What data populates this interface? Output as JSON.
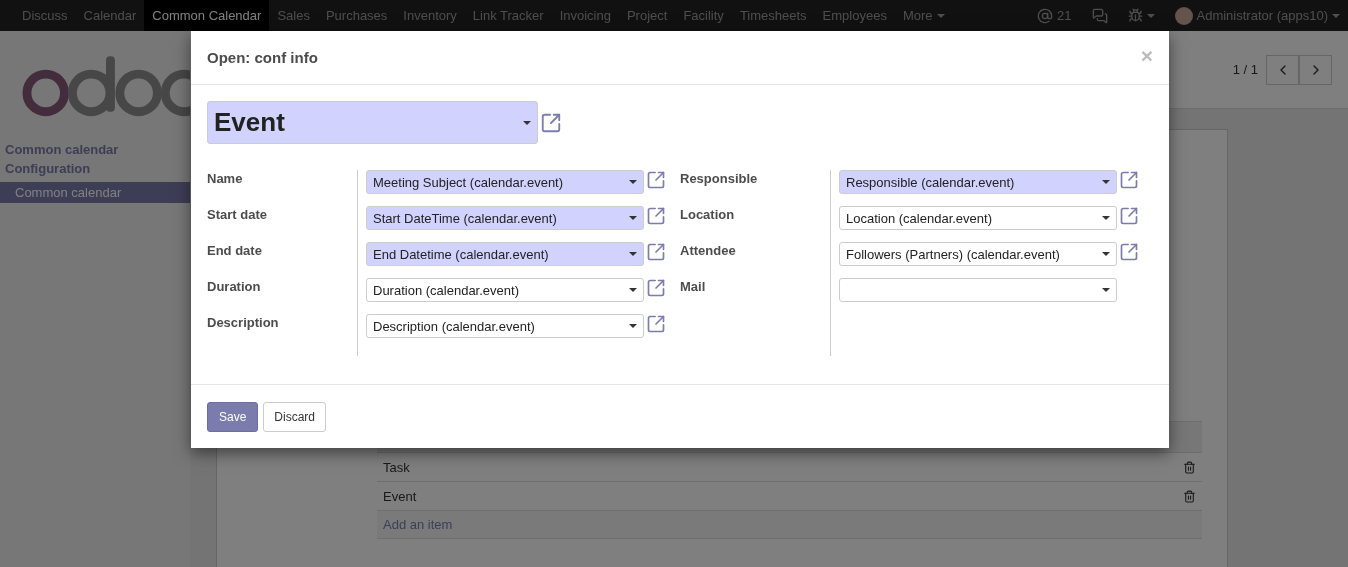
{
  "navbar": {
    "menu": [
      {
        "label": "Discuss",
        "selected": false
      },
      {
        "label": "Calendar",
        "selected": false
      },
      {
        "label": "Common Calendar",
        "selected": true
      },
      {
        "label": "Sales",
        "selected": false
      },
      {
        "label": "Purchases",
        "selected": false
      },
      {
        "label": "Inventory",
        "selected": false
      },
      {
        "label": "Link Tracker",
        "selected": false
      },
      {
        "label": "Invoicing",
        "selected": false
      },
      {
        "label": "Project",
        "selected": false
      },
      {
        "label": "Facility",
        "selected": false
      },
      {
        "label": "Timesheets",
        "selected": false
      },
      {
        "label": "Employees",
        "selected": false
      }
    ],
    "more": "More",
    "mentions": "21",
    "user": "Administrator (apps10)"
  },
  "sidebar": {
    "section": "Common calendar",
    "subsection": "Configuration",
    "items": [
      {
        "label": "Common calendar",
        "selected": true
      }
    ]
  },
  "pager": {
    "counter": "1 / 1"
  },
  "lines_table": {
    "rows": [
      {
        "label": "Task"
      },
      {
        "label": "Event"
      }
    ],
    "add_item": "Add an item"
  },
  "dialog": {
    "title": "Open: conf info",
    "close": "×",
    "model": "Event",
    "left_fields": [
      {
        "label": "Name",
        "value": "Meeting Subject (calendar.event)",
        "required": true
      },
      {
        "label": "Start date",
        "value": "Start DateTime (calendar.event)",
        "required": true
      },
      {
        "label": "End date",
        "value": "End Datetime (calendar.event)",
        "required": true
      },
      {
        "label": "Duration",
        "value": "Duration (calendar.event)",
        "required": false
      },
      {
        "label": "Description",
        "value": "Description (calendar.event)",
        "required": false
      }
    ],
    "right_fields": [
      {
        "label": "Responsible",
        "value": "Responsible (calendar.event)",
        "required": true
      },
      {
        "label": "Location",
        "value": "Location (calendar.event)",
        "required": false
      },
      {
        "label": "Attendee",
        "value": "Followers (Partners) (calendar.event)",
        "required": false
      },
      {
        "label": "Mail",
        "required": false
      }
    ],
    "buttons": {
      "save": "Save",
      "discard": "Discard"
    }
  }
}
